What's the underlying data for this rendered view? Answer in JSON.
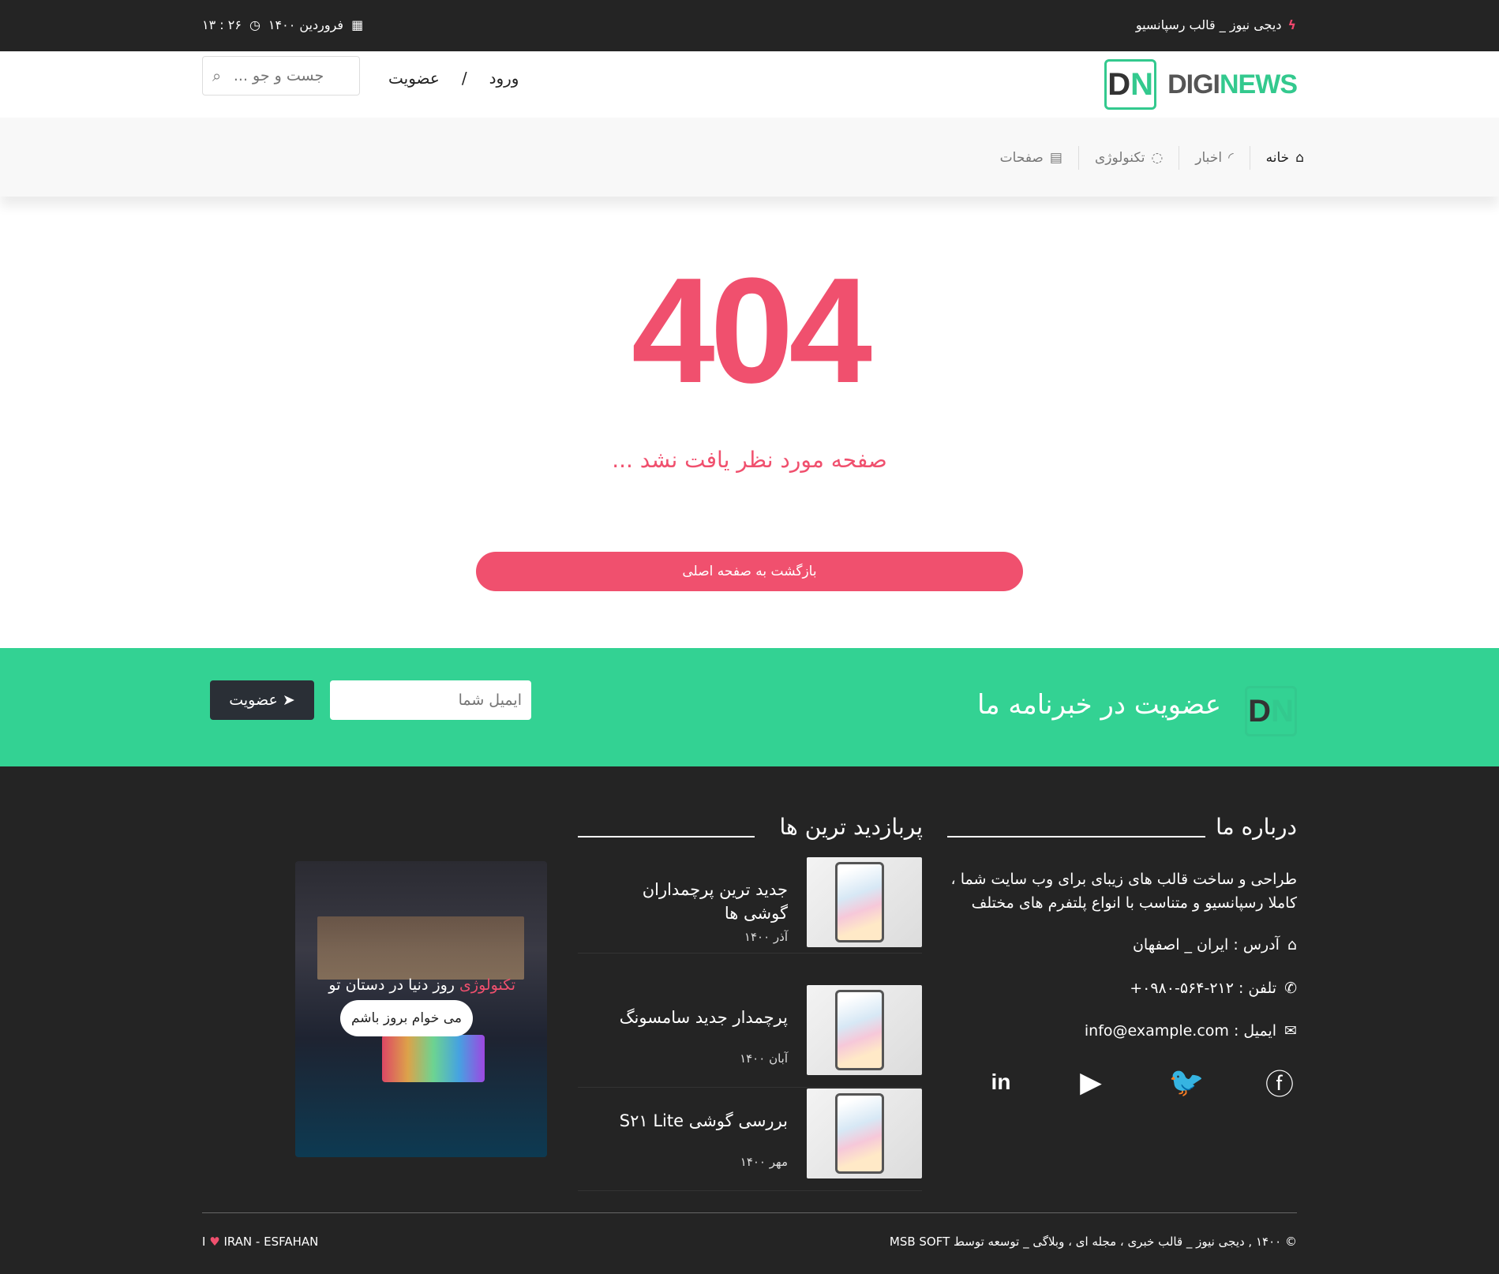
{
  "topbar": {
    "title": "دیجی نیوز _ قالب رسپانسیو",
    "date": "فروردین ۱۴۰۰",
    "time": "۲۶ : ۱۳"
  },
  "header": {
    "logo_text_a": "DIGI",
    "logo_text_b": "NEWS",
    "logo_mark_a": "D",
    "logo_mark_b": "N",
    "login": "ورود",
    "separator": "/",
    "register": "عضویت",
    "search_placeholder": "جست و جو ..."
  },
  "nav": {
    "items": [
      {
        "label": "خانه",
        "icon": "home-icon"
      },
      {
        "label": "اخبار",
        "icon": "rss-icon"
      },
      {
        "label": "تکنولوژی",
        "icon": "circle-icon"
      },
      {
        "label": "صفحات",
        "icon": "file-icon"
      }
    ]
  },
  "error": {
    "code": "404",
    "message": "صفحه مورد نظر یافت نشد ...",
    "button": "بازگشت به صفحه اصلی"
  },
  "newsletter": {
    "title": "عضویت در خبرنامه ما",
    "email_placeholder": "ایمیل شما",
    "button": "عضویت"
  },
  "footer": {
    "about_title": "درباره ما",
    "about_text": "طراحی و ساخت قالب های زیبای برای وب سایت شما ، کاملا رسپانسیو و متناسب با انواع پلتفرم های مختلف",
    "address": "آدرس : ایران _ اصفهان",
    "phone": "تلفن : ۲۱۲-۵۶۴-۰۹۸۰+",
    "email": "ایمیل : info@example.com",
    "popular_title": "پربازدید ترین ها",
    "posts": [
      {
        "title": "جدید ترین پرچمداران گوشی ها",
        "date": "آذر ۱۴۰۰"
      },
      {
        "title": "پرچمدار جدید سامسونگ",
        "date": "آبان ۱۴۰۰"
      },
      {
        "title": "بررسی گوشی S۲۱ Lite",
        "date": "مهر ۱۴۰۰"
      }
    ],
    "promo": {
      "accent": "تکنولوژی",
      "text": " روز دنیا در دستان تو",
      "button": "می خوام بروز باشم"
    },
    "copyright": "© ۱۴۰۰ , دیجی نیوز _ قالب خبری ، مجله ای ، وبلاگی _ توسعه توسط MSB SOFT",
    "location": "IRAN - ESFAHAN"
  },
  "colors": {
    "accent": "#f0506e",
    "green": "#33d293",
    "dark": "#242424"
  }
}
